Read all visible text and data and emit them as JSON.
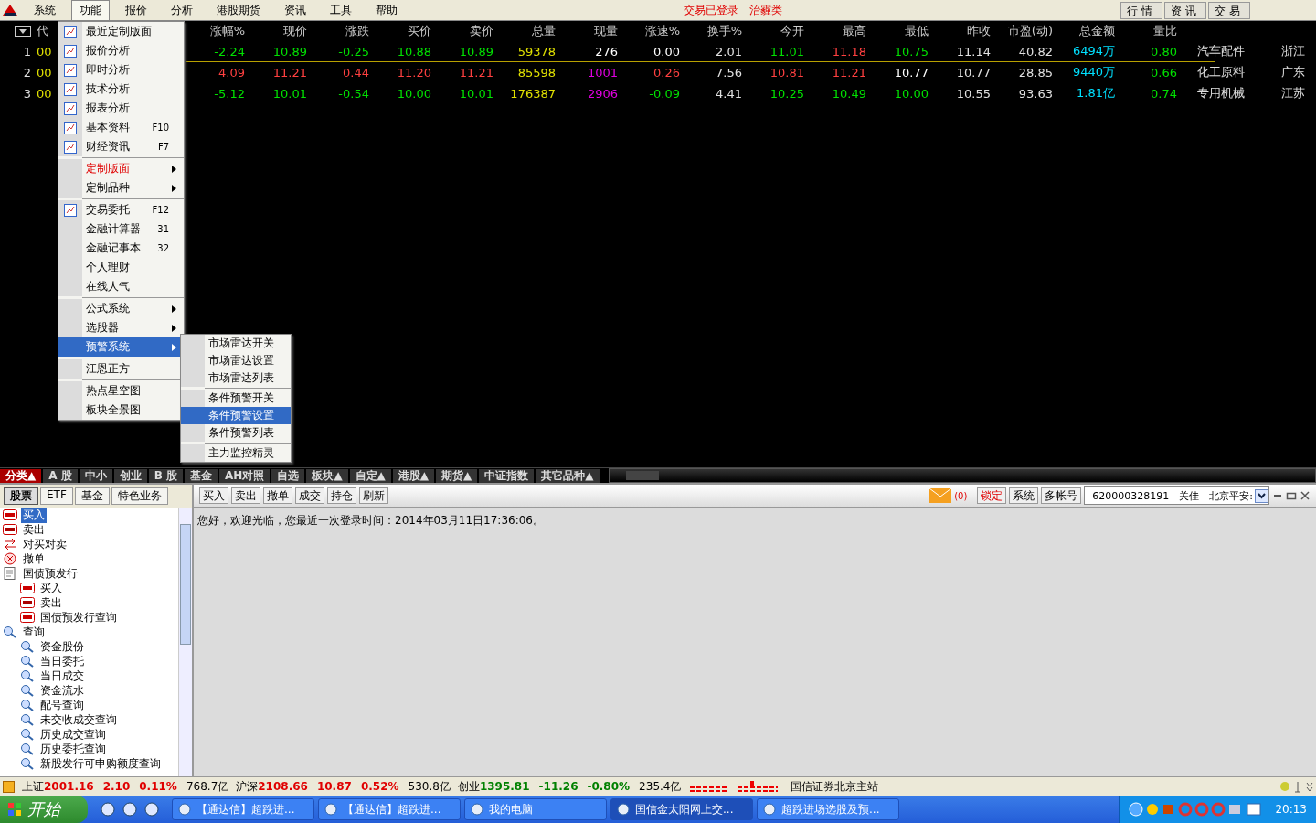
{
  "menubar": {
    "items": [
      {
        "label": "系统",
        "selected": false
      },
      {
        "label": "功能",
        "selected": true
      },
      {
        "label": "报价",
        "selected": false
      },
      {
        "label": "分析",
        "selected": false
      },
      {
        "label": "港股期货",
        "selected": false
      },
      {
        "label": "资讯",
        "selected": false
      },
      {
        "label": "工具",
        "selected": false
      },
      {
        "label": "帮助",
        "selected": false
      }
    ],
    "login_status": "交易已登录",
    "block_name": "治霾类",
    "view_tabs": [
      "行情",
      "资讯",
      "交易"
    ]
  },
  "quote_table": {
    "code_header": "代",
    "columns": [
      "涨幅%",
      "现价",
      "涨跌",
      "买价",
      "卖价",
      "总量",
      "现量",
      "涨速%",
      "换手%",
      "今开",
      "最高",
      "最低",
      "昨收",
      "市盈(动)",
      "总金额",
      "量比"
    ],
    "rows": [
      {
        "num": "1",
        "code": "00",
        "selected": true,
        "cells": [
          {
            "text": "-2.24",
            "color": "#00e000"
          },
          {
            "text": "10.89",
            "color": "#00e000"
          },
          {
            "text": "-0.25",
            "color": "#00e000"
          },
          {
            "text": "10.88",
            "color": "#00e000"
          },
          {
            "text": "10.89",
            "color": "#00e000"
          },
          {
            "text": "59378",
            "color": "#e0e000"
          },
          {
            "text": "276",
            "color": "#ffffff"
          },
          {
            "text": "0.00",
            "color": "#ffffff"
          },
          {
            "text": "2.01",
            "color": "#e0e0e0"
          },
          {
            "text": "11.01",
            "color": "#00e000"
          },
          {
            "text": "11.18",
            "color": "#ff4040"
          },
          {
            "text": "10.75",
            "color": "#00e000"
          },
          {
            "text": "11.14",
            "color": "#e0e0e0"
          },
          {
            "text": "40.82",
            "color": "#e0e0e0"
          },
          {
            "text": "6494万",
            "color": "#00e0ff"
          },
          {
            "text": "0.80",
            "color": "#00e000"
          }
        ],
        "industry": "汽车配件",
        "region": "浙江"
      },
      {
        "num": "2",
        "code": "00",
        "selected": false,
        "cells": [
          {
            "text": "4.09",
            "color": "#ff4040"
          },
          {
            "text": "11.21",
            "color": "#ff4040"
          },
          {
            "text": "0.44",
            "color": "#ff4040"
          },
          {
            "text": "11.20",
            "color": "#ff4040"
          },
          {
            "text": "11.21",
            "color": "#ff4040"
          },
          {
            "text": "85598",
            "color": "#e0e000"
          },
          {
            "text": "1001",
            "color": "#e000e0"
          },
          {
            "text": "0.26",
            "color": "#ff4040"
          },
          {
            "text": "7.56",
            "color": "#e0e0e0"
          },
          {
            "text": "10.81",
            "color": "#ff4040"
          },
          {
            "text": "11.21",
            "color": "#ff4040"
          },
          {
            "text": "10.77",
            "color": "#ffffff"
          },
          {
            "text": "10.77",
            "color": "#e0e0e0"
          },
          {
            "text": "28.85",
            "color": "#e0e0e0"
          },
          {
            "text": "9440万",
            "color": "#00e0ff"
          },
          {
            "text": "0.66",
            "color": "#00e000"
          }
        ],
        "industry": "化工原料",
        "region": "广东"
      },
      {
        "num": "3",
        "code": "00",
        "selected": false,
        "cells": [
          {
            "text": "-5.12",
            "color": "#00e000"
          },
          {
            "text": "10.01",
            "color": "#00e000"
          },
          {
            "text": "-0.54",
            "color": "#00e000"
          },
          {
            "text": "10.00",
            "color": "#00e000"
          },
          {
            "text": "10.01",
            "color": "#00e000"
          },
          {
            "text": "176387",
            "color": "#e0e000"
          },
          {
            "text": "2906",
            "color": "#e000e0"
          },
          {
            "text": "-0.09",
            "color": "#00e000"
          },
          {
            "text": "4.41",
            "color": "#e0e0e0"
          },
          {
            "text": "10.25",
            "color": "#00e000"
          },
          {
            "text": "10.49",
            "color": "#00e000"
          },
          {
            "text": "10.00",
            "color": "#00e000"
          },
          {
            "text": "10.55",
            "color": "#e0e0e0"
          },
          {
            "text": "93.63",
            "color": "#e0e0e0"
          },
          {
            "text": "1.81亿",
            "color": "#00e0ff"
          },
          {
            "text": "0.74",
            "color": "#00e000"
          }
        ],
        "industry": "专用机械",
        "region": "江苏"
      }
    ]
  },
  "function_menu": [
    {
      "kind": "item",
      "label": "最近定制版面",
      "has_icon": true,
      "selected": false
    },
    {
      "kind": "item",
      "label": "报价分析",
      "has_icon": true,
      "selected": false
    },
    {
      "kind": "item",
      "label": "即时分析",
      "has_icon": true,
      "selected": false
    },
    {
      "kind": "item",
      "label": "技术分析",
      "has_icon": true,
      "selected": false
    },
    {
      "kind": "item",
      "label": "报表分析",
      "has_icon": true,
      "selected": false
    },
    {
      "kind": "item",
      "label": "基本资料",
      "shortcut": "F10",
      "has_icon": true,
      "selected": false
    },
    {
      "kind": "item",
      "label": "财经资讯",
      "shortcut": "F7",
      "has_icon": true,
      "selected": false
    },
    {
      "kind": "separator"
    },
    {
      "kind": "item",
      "label": "定制版面",
      "submenu": true,
      "accent": true,
      "selected": false
    },
    {
      "kind": "item",
      "label": "定制品种",
      "submenu": true,
      "selected": false
    },
    {
      "kind": "separator"
    },
    {
      "kind": "item",
      "label": "交易委托",
      "shortcut": "F12",
      "has_icon": true,
      "selected": false
    },
    {
      "kind": "item",
      "label": "金融计算器",
      "shortcut": "31",
      "selected": false
    },
    {
      "kind": "item",
      "label": "金融记事本",
      "shortcut": "32",
      "selected": false
    },
    {
      "kind": "item",
      "label": "个人理财",
      "selected": false
    },
    {
      "kind": "item",
      "label": "在线人气",
      "selected": false
    },
    {
      "kind": "separator"
    },
    {
      "kind": "item",
      "label": "公式系统",
      "submenu": true,
      "selected": false
    },
    {
      "kind": "item",
      "label": "选股器",
      "submenu": true,
      "selected": false
    },
    {
      "kind": "item",
      "label": "预警系统",
      "submenu": true,
      "selected": true
    },
    {
      "kind": "separator"
    },
    {
      "kind": "item",
      "label": "江恩正方",
      "selected": false
    },
    {
      "kind": "separator"
    },
    {
      "kind": "item",
      "label": "热点星空图",
      "selected": false
    },
    {
      "kind": "item",
      "label": "板块全景图",
      "selected": false
    }
  ],
  "alert_submenu": [
    {
      "kind": "item",
      "label": "市场雷达开关",
      "selected": false
    },
    {
      "kind": "item",
      "label": "市场雷达设置",
      "selected": false
    },
    {
      "kind": "item",
      "label": "市场雷达列表",
      "selected": false
    },
    {
      "kind": "separator"
    },
    {
      "kind": "item",
      "label": "条件预警开关",
      "selected": false
    },
    {
      "kind": "item",
      "label": "条件预警设置",
      "selected": true
    },
    {
      "kind": "item",
      "label": "条件预警列表",
      "selected": false
    },
    {
      "kind": "separator"
    },
    {
      "kind": "item",
      "label": "主力监控精灵",
      "selected": false
    }
  ],
  "category_tabs": [
    {
      "label": "分类▲",
      "selected": true
    },
    {
      "label": "A 股",
      "selected": false
    },
    {
      "label": "中小",
      "selected": false
    },
    {
      "label": "创业",
      "selected": false
    },
    {
      "label": "B 股",
      "selected": false
    },
    {
      "label": "基金",
      "selected": false
    },
    {
      "label": "AH对照",
      "selected": false
    },
    {
      "label": "自选",
      "selected": false
    },
    {
      "label": "板块▲",
      "selected": false
    },
    {
      "label": "自定▲",
      "selected": false
    },
    {
      "label": "港股▲",
      "selected": false
    },
    {
      "label": "期货▲",
      "selected": false
    },
    {
      "label": "中证指数",
      "selected": false
    },
    {
      "label": "其它品种▲",
      "selected": false
    }
  ],
  "trade_panel": {
    "tabs": [
      {
        "label": "股票",
        "selected": true
      },
      {
        "label": "ETF",
        "selected": false
      },
      {
        "label": "基金",
        "selected": false
      },
      {
        "label": "特色业务",
        "selected": false
      }
    ],
    "tree": [
      {
        "label": "买入",
        "kind": "buy",
        "selected": true
      },
      {
        "label": "卖出",
        "kind": "sell",
        "selected": false
      },
      {
        "label": "对买对卖",
        "kind": "swap",
        "selected": false
      },
      {
        "label": "撤单",
        "kind": "cancel",
        "selected": false
      },
      {
        "label": "国债预发行",
        "kind": "folder",
        "selected": false,
        "children": [
          {
            "label": "买入",
            "kind": "buy",
            "selected": false
          },
          {
            "label": "卖出",
            "kind": "sell",
            "selected": false
          },
          {
            "label": "国债预发行查询",
            "kind": "buy",
            "selected": false
          }
        ]
      },
      {
        "label": "查询",
        "kind": "query",
        "selected": false,
        "children": [
          {
            "label": "资金股份",
            "kind": "query",
            "selected": false
          },
          {
            "label": "当日委托",
            "kind": "query",
            "selected": false
          },
          {
            "label": "当日成交",
            "kind": "query",
            "selected": false
          },
          {
            "label": "资金流水",
            "kind": "query",
            "selected": false
          },
          {
            "label": "配号查询",
            "kind": "query",
            "selected": false
          },
          {
            "label": "未交收成交查询",
            "kind": "query",
            "selected": false
          },
          {
            "label": "历史成交查询",
            "kind": "query",
            "selected": false
          },
          {
            "label": "历史委托查询",
            "kind": "query",
            "selected": false
          },
          {
            "label": "新股发行可申购额度查询",
            "kind": "query",
            "selected": false
          }
        ]
      }
    ],
    "toolbar": [
      "买入",
      "卖出",
      "撤单",
      "成交",
      "持仓",
      "刷新"
    ],
    "mail_count": "(0)",
    "right_buttons": [
      {
        "label": "锁定",
        "accent": true
      },
      {
        "label": "系统",
        "accent": false
      },
      {
        "label": "多帐号",
        "accent": false
      }
    ],
    "account": "620000328191　关佳　北京平安:",
    "message": "您好，欢迎光临，您最近一次登录时间：2014年03月11日17:36:06。"
  },
  "status_bar": {
    "indices": [
      {
        "name": "上证",
        "value": "2001.16",
        "change": "2.10",
        "pct": "0.11%",
        "amount": "768.7亿",
        "color": "#e00000"
      },
      {
        "name": "沪深",
        "value": "2108.66",
        "change": "10.87",
        "pct": "0.52%",
        "amount": "530.8亿",
        "color": "#e00000"
      },
      {
        "name": "创业",
        "value": "1395.81",
        "change": "-11.26",
        "pct": "-0.80%",
        "amount": "235.4亿",
        "color": "#008000"
      }
    ],
    "server": "国信证券北京主站"
  },
  "taskbar": {
    "start": "开始",
    "tasks": [
      {
        "label": "【通达信】超跌进...",
        "selected": false
      },
      {
        "label": "【通达信】超跌进...",
        "selected": false
      },
      {
        "label": "我的电脑",
        "selected": false
      },
      {
        "label": "国信金太阳网上交...",
        "selected": true
      },
      {
        "label": "超跌进场选股及预...",
        "selected": false
      }
    ],
    "clock": "20:13"
  }
}
